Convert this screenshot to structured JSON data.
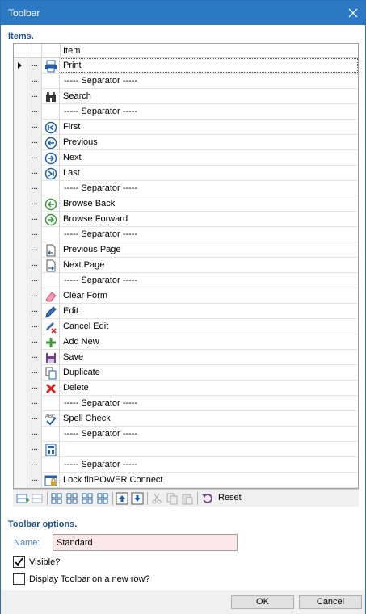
{
  "window": {
    "title": "Toolbar",
    "close_icon": "close-icon"
  },
  "items_section": {
    "title": "Items."
  },
  "grid": {
    "header": {
      "item": "Item"
    },
    "dots_label": "...",
    "rows": [
      {
        "label": "Print",
        "icon": "print-icon",
        "selected": true
      },
      {
        "label": "----- Separator -----",
        "icon": ""
      },
      {
        "label": "Search",
        "icon": "binoculars-icon"
      },
      {
        "label": "----- Separator -----",
        "icon": ""
      },
      {
        "label": "First",
        "icon": "first-icon"
      },
      {
        "label": "Previous",
        "icon": "previous-icon"
      },
      {
        "label": "Next",
        "icon": "next-icon"
      },
      {
        "label": "Last",
        "icon": "last-icon"
      },
      {
        "label": "----- Separator -----",
        "icon": ""
      },
      {
        "label": "Browse Back",
        "icon": "browse-back-icon"
      },
      {
        "label": "Browse Forward",
        "icon": "browse-forward-icon"
      },
      {
        "label": "----- Separator -----",
        "icon": ""
      },
      {
        "label": "Previous Page",
        "icon": "previous-page-icon"
      },
      {
        "label": "Next Page",
        "icon": "next-page-icon"
      },
      {
        "label": "----- Separator -----",
        "icon": ""
      },
      {
        "label": "Clear Form",
        "icon": "eraser-icon"
      },
      {
        "label": "Edit",
        "icon": "pencil-icon"
      },
      {
        "label": "Cancel Edit",
        "icon": "cancel-edit-icon"
      },
      {
        "label": "Add New",
        "icon": "plus-icon"
      },
      {
        "label": "Save",
        "icon": "save-icon"
      },
      {
        "label": "Duplicate",
        "icon": "duplicate-icon"
      },
      {
        "label": "Delete",
        "icon": "delete-icon"
      },
      {
        "label": "----- Separator -----",
        "icon": ""
      },
      {
        "label": "Spell Check",
        "icon": "spell-check-icon"
      },
      {
        "label": "----- Separator -----",
        "icon": ""
      },
      {
        "label": "",
        "icon": "calculator-icon"
      },
      {
        "label": "----- Separator -----",
        "icon": ""
      },
      {
        "label": "Lock finPOWER Connect",
        "icon": "lock-screen-icon"
      }
    ]
  },
  "grid_toolbar": {
    "reset_label": "Reset"
  },
  "options_section": {
    "title": "Toolbar options.",
    "name_label": "Name:",
    "name_value": "Standard",
    "visible_label": "Visible?",
    "visible_checked": true,
    "new_row_label": "Display Toolbar on a new row?",
    "new_row_checked": false
  },
  "footer": {
    "ok_label": "OK",
    "cancel_label": "Cancel"
  }
}
